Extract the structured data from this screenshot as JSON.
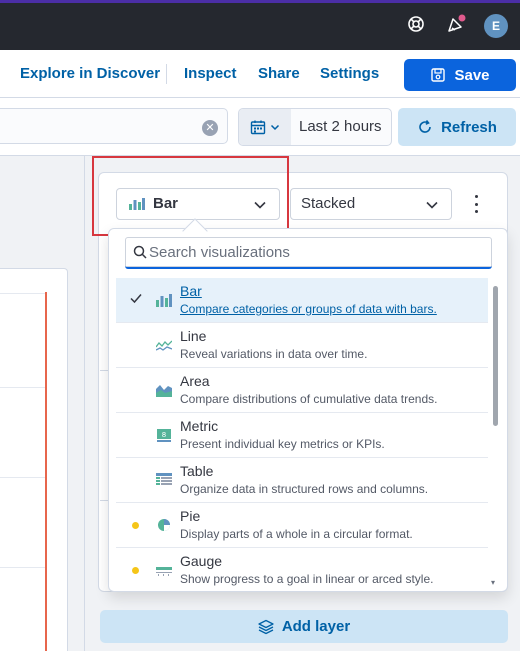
{
  "header": {
    "avatar_initial": "E",
    "colors": {
      "topbar": "#25282f",
      "accent": "#4b2ea6",
      "avatar": "#6092c0",
      "notification": "#e05a8d"
    }
  },
  "toolbar": {
    "explore_label": "Explore in Discover",
    "inspect_label": "Inspect",
    "share_label": "Share",
    "settings_label": "Settings",
    "save_label": "Save"
  },
  "query": {
    "date_range": "Last 2 hours",
    "refresh_label": "Refresh"
  },
  "layer": {
    "vis_type": "Bar",
    "mode": "Stacked",
    "add_layer_label": "Add layer"
  },
  "popover": {
    "search_placeholder": "Search visualizations",
    "items": [
      {
        "name": "Bar",
        "desc": "Compare categories or groups of data with bars.",
        "icon": "bar-chart-icon",
        "selected": true,
        "badge": false
      },
      {
        "name": "Line",
        "desc": "Reveal variations in data over time.",
        "icon": "line-chart-icon",
        "selected": false,
        "badge": false
      },
      {
        "name": "Area",
        "desc": "Compare distributions of cumulative data trends.",
        "icon": "area-chart-icon",
        "selected": false,
        "badge": false
      },
      {
        "name": "Metric",
        "desc": "Present individual key metrics or KPIs.",
        "icon": "metric-icon",
        "selected": false,
        "badge": false
      },
      {
        "name": "Table",
        "desc": "Organize data in structured rows and columns.",
        "icon": "table-icon",
        "selected": false,
        "badge": false
      },
      {
        "name": "Pie",
        "desc": "Display parts of a whole in a circular format.",
        "icon": "pie-chart-icon",
        "selected": false,
        "badge": true
      },
      {
        "name": "Gauge",
        "desc": "Show progress to a goal in linear or arced style.",
        "icon": "gauge-icon",
        "selected": false,
        "badge": true
      }
    ]
  }
}
